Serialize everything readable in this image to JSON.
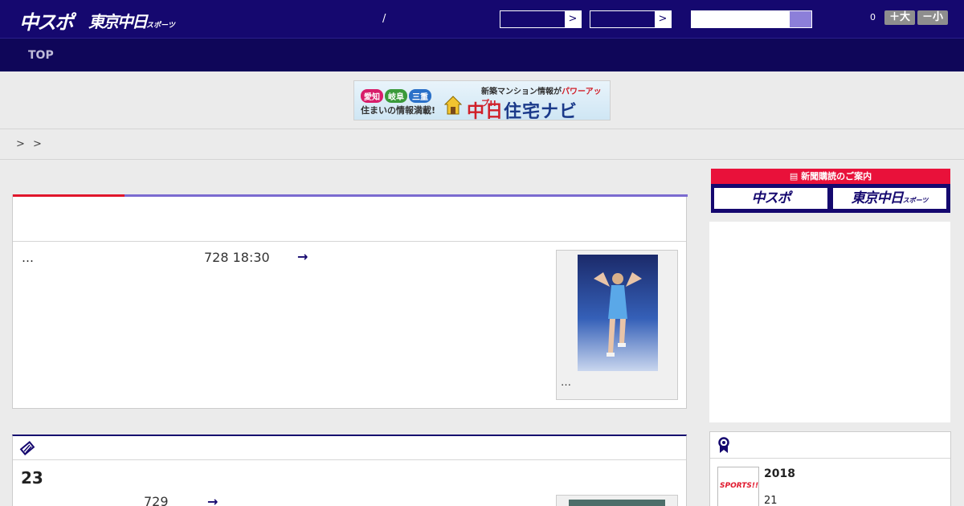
{
  "header": {
    "logo_chuspo": "中スポ",
    "logo_tokyo": "東京中日",
    "logo_tokyo_small": "スポーツ",
    "slash": "/",
    "select1_arrow": ">",
    "select2_arrow": ">",
    "count": "0",
    "font_larger_label": "＋大",
    "font_smaller_label": "－小"
  },
  "nav": {
    "top_label": "TOP"
  },
  "banner": {
    "pref_aichi": "愛知",
    "pref_gifu": "岐阜",
    "pref_mie": "三重",
    "tagline": "住まいの情報満載!",
    "headline_prefix": "新築マンション情報が",
    "headline_emphasis": "パワーアップ!!",
    "brand_red": "中日",
    "brand_navy": "住宅ナビ"
  },
  "breadcrumb": {
    "text": "> >"
  },
  "main_article": {
    "ellipsis": "…",
    "date": "728 18:30",
    "more_arrow": "→",
    "photo_caption": "…"
  },
  "second_article": {
    "title": "23",
    "date": "729",
    "more_arrow": "→"
  },
  "sidebar": {
    "subscribe_title": "新聞購読のご案内",
    "subscribe_chuspo": "中スポ",
    "subscribe_tokyo": "東京中日",
    "subscribe_tokyo_small": "スポーツ",
    "rank_year": "2018",
    "rank_number": "21",
    "rank_thumb_text": "SPORTS!!"
  },
  "colors": {
    "header_bg": "#15086f",
    "nav_bg": "#0f0659",
    "accent_red": "#e0162b",
    "accent_purple": "#7a6ad0",
    "subscribe_red": "#e9113a"
  },
  "icons": {
    "pencil": "pencil-icon",
    "medal": "medal-icon",
    "newspaper": "newspaper-icon"
  }
}
